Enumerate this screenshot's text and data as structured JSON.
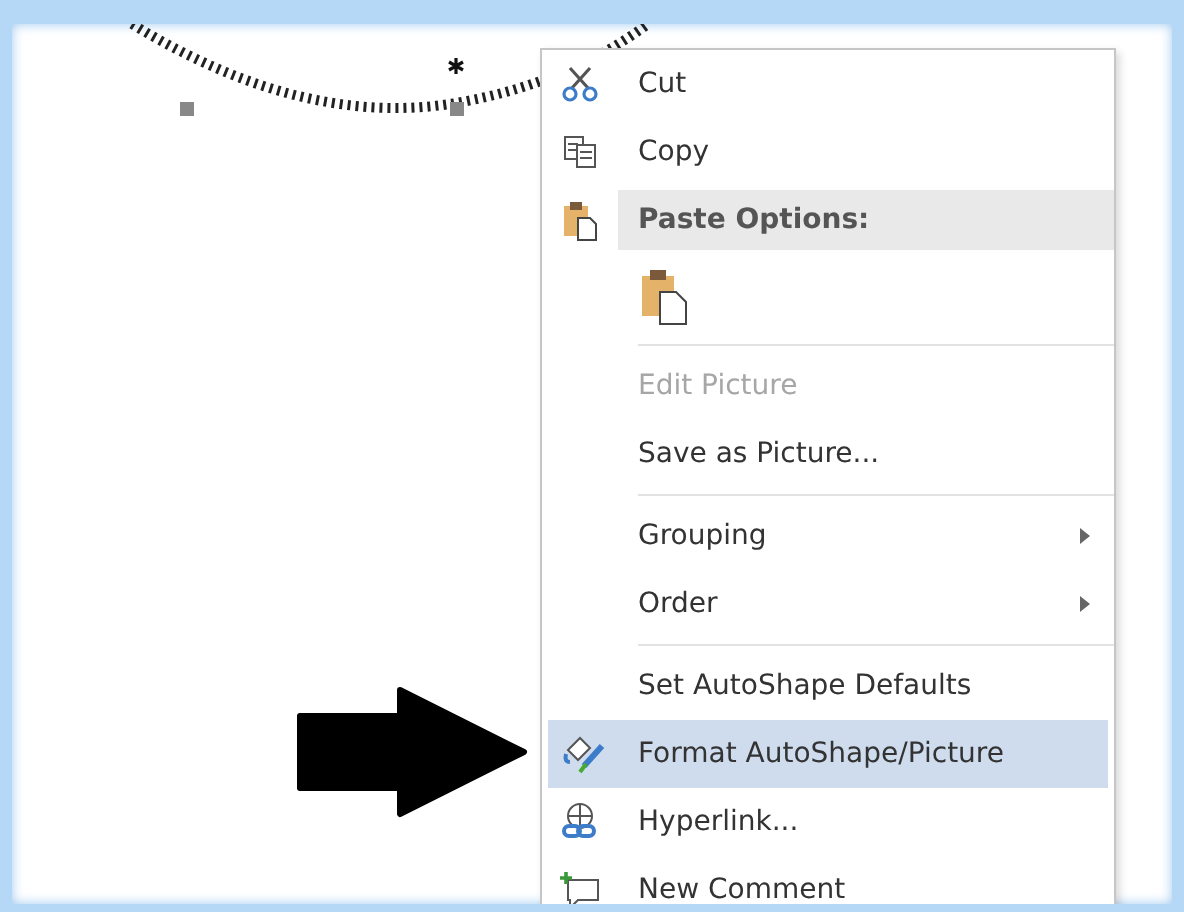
{
  "menu": {
    "items": [
      {
        "kind": "command",
        "label": "Cut",
        "disabled": false,
        "submenu": false,
        "selected": false
      },
      {
        "kind": "command",
        "label": "Copy",
        "disabled": false,
        "submenu": false,
        "selected": false
      },
      {
        "kind": "header",
        "label": "Paste Options:"
      },
      {
        "kind": "paste-option"
      },
      {
        "kind": "separator"
      },
      {
        "kind": "command",
        "label": "Edit Picture",
        "disabled": true,
        "submenu": false,
        "selected": false
      },
      {
        "kind": "command",
        "label": "Save as Picture...",
        "disabled": false,
        "submenu": false,
        "selected": false
      },
      {
        "kind": "separator"
      },
      {
        "kind": "command",
        "label": "Grouping",
        "disabled": false,
        "submenu": true,
        "selected": false
      },
      {
        "kind": "command",
        "label": "Order",
        "disabled": false,
        "submenu": true,
        "selected": false
      },
      {
        "kind": "separator"
      },
      {
        "kind": "command",
        "label": "Set AutoShape Defaults",
        "disabled": false,
        "submenu": false,
        "selected": false
      },
      {
        "kind": "command",
        "label": "Format AutoShape/Picture",
        "disabled": false,
        "submenu": false,
        "selected": true
      },
      {
        "kind": "command",
        "label": "Hyperlink...",
        "disabled": false,
        "submenu": false,
        "selected": false
      },
      {
        "kind": "command",
        "label": "New Comment",
        "disabled": false,
        "submenu": false,
        "selected": false
      }
    ]
  }
}
